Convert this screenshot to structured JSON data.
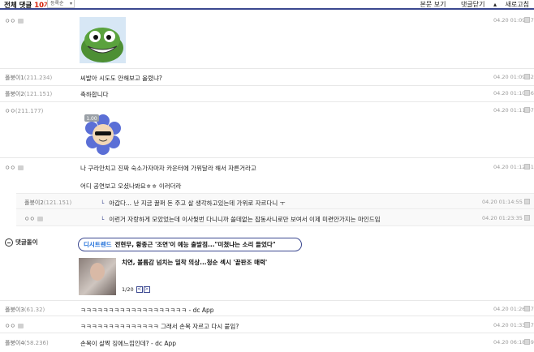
{
  "header": {
    "title_prefix": "전체 댓글",
    "count": "10개",
    "sort": "등록순",
    "view_body": "본문 보기",
    "collapse": "댓글닫기",
    "refresh": "새로고침"
  },
  "comments": [
    {
      "nick": "ㅇㅇ",
      "ip": "",
      "text": "",
      "time": "04.20 01:09:27",
      "media": "pepe-emoticon"
    },
    {
      "nick": "폴붕이1",
      "ip": "(211.234)",
      "text": "씨발아 시도도 안해보고 올렸냐?",
      "time": "04.20 01:09:32"
    },
    {
      "nick": "폴붕이2",
      "ip": "(121.151)",
      "text": "축하합니다",
      "time": "04.20 01:10:36"
    },
    {
      "nick": "ㅇㅇ",
      "ip": "(211.177)",
      "text": "",
      "time": "04.20 01:11:07",
      "media": "flower-emoticon",
      "badge": "1.00"
    },
    {
      "nick": "ㅇㅇ",
      "ip": "",
      "text": "나 구라안치고 진짜 숙소가자마자 카운터에 가위달라 해서 자른거라고",
      "text2": "어디 공연보고 오셨나봐요ㅎㅎ 이러더라",
      "time": "04.20 01:12:51"
    }
  ],
  "replies": [
    {
      "nick": "폴붕이2",
      "ip": "(121.151)",
      "text": "아갑다... 난 지금 꿀퍼 돈 주고 살 생각하고있는데 가위로 자르다니 ㅜ",
      "time": "04.20 01:14:55"
    },
    {
      "nick": "ㅇㅇ",
      "ip": "",
      "text": "이런거 자랑하게 모았었는데 이사뒻번 다니니까 쓸데없는 잡동사니로만 보여서 이제 미련안가지는 마인드임",
      "time": "04.20 01:23:35"
    }
  ],
  "dcbot": {
    "label": "댓글돌이",
    "tag": "디시트렌드",
    "headline": "전현무, 황종근 '조연'이 예능 출발점...\"미쳤냐는 소리 들었다\"",
    "sub_headline": "치연, 볼륨감 넘치는 밀착 의상...청순 섹시 '끝판조 매력'",
    "page": "1/20",
    "prev": "<",
    "next": ">"
  },
  "comments_bottom": [
    {
      "nick": "폴붕이3",
      "ip": "(61.32)",
      "text": "ㅋㅋㅋㅋㅋㅋㅋㅋㅋㅋㅋㅋㅋㅋㅋㅋㅋㅋㅋ - dc App",
      "time": "04.20 01:26:17"
    },
    {
      "nick": "ㅇㅇ",
      "ip": "",
      "text": "ㅋㅋㅋㅋㅋㅋㅋㅋㅋㅋㅋㅋㅋㅋ 그래서 손목 자르고 다시 붙임?",
      "time": "04.20 01:33:17"
    },
    {
      "nick": "폴붕이4",
      "ip": "(58.236)",
      "text": "손목이 살짝 징에느낌인데? - dc App",
      "time": "04.20 06:18:59"
    }
  ]
}
